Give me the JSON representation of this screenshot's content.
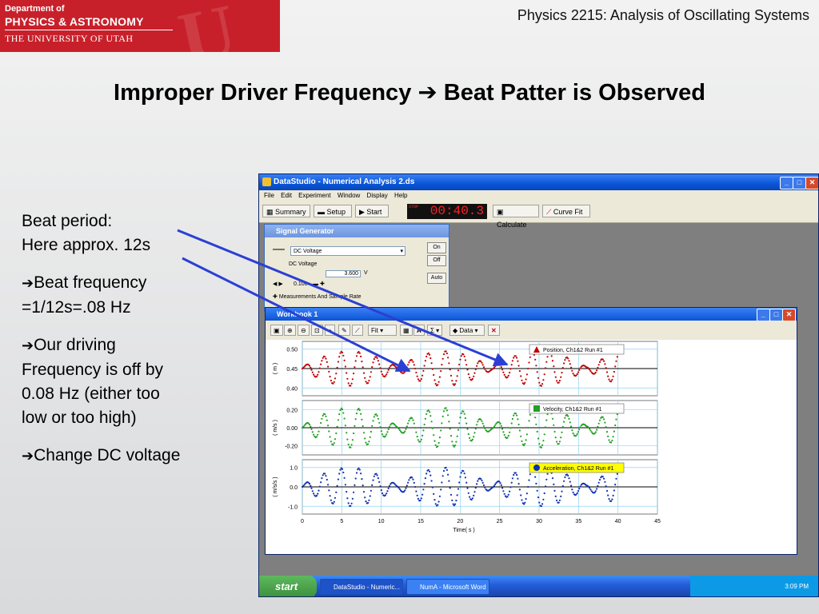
{
  "header": {
    "logo_line1": "Department of",
    "logo_line2": "PHYSICS & ASTRONOMY",
    "logo_line3": "THE UNIVERSITY OF UTAH",
    "course_title": "Physics 2215: Analysis of Oscillating Systems"
  },
  "slide": {
    "title_part1": "Improper Driver Frequency",
    "title_arrow": "➔",
    "title_part2": "Beat Patter is Observed",
    "arrow": "➔",
    "note1_line1": "Beat period:",
    "note1_line2": "Here approx. 12s",
    "note2_line1": "Beat frequency",
    "note2_line2": "=1/12s=.08 Hz",
    "note3": "Our driving Frequency is off by 0.08 Hz (either too low or too high)",
    "note4": "Change DC voltage"
  },
  "app": {
    "window_title": "DataStudio - Numerical Analysis 2.ds",
    "menu": [
      "File",
      "Edit",
      "Experiment",
      "Window",
      "Display",
      "Help"
    ],
    "toolbar": {
      "summary": "Summary",
      "setup": "Setup",
      "start": "Start",
      "stop_label": "STOP",
      "timer": "00:40.3",
      "calculate": "Calculate",
      "curve_fit": "Curve Fit"
    },
    "signal_generator": {
      "title": "Signal Generator",
      "waveform": "DC Voltage",
      "label": "DC Voltage",
      "value": "3.600",
      "unit": "V",
      "step": "0.100",
      "measurements": "Measurements And Sample Rate",
      "on": "On",
      "off": "Off",
      "auto": "Auto"
    },
    "workbook": {
      "title": "Workbook 1",
      "fit": "Fit",
      "data": "Data"
    },
    "taskbar": {
      "start": "start",
      "task1": "DataStudio - Numeric...",
      "task2": "NumA - Microsoft Word",
      "clock": "3:09 PM"
    }
  },
  "chart_data": {
    "type": "line",
    "xlabel": "Time( s )",
    "xlim": [
      0,
      45
    ],
    "x_ticks": [
      "0",
      "5",
      "10",
      "15",
      "20",
      "25",
      "30",
      "35",
      "40",
      "45"
    ],
    "beat_period_s": 12,
    "panels": [
      {
        "name": "Position, Ch1&2 Run #1",
        "ylabel": "( m )",
        "y_ticks": [
          "0.50",
          "0.45",
          "0.40"
        ],
        "ylim": [
          0.38,
          0.52
        ],
        "center": 0.45,
        "amplitude": 0.045,
        "color": "#c00000",
        "marker": "triangle"
      },
      {
        "name": "Velocity, Ch1&2 Run #1",
        "ylabel": "( m/s )",
        "y_ticks": [
          "0.20",
          "0.00",
          "-0.20"
        ],
        "ylim": [
          -0.3,
          0.3
        ],
        "center": 0,
        "amplitude": 0.22,
        "color": "#22a022",
        "marker": "square"
      },
      {
        "name": "Acceleration, Ch1&2 Run #1",
        "ylabel": "( m/s/s )",
        "y_ticks": [
          "1.0",
          "0.0",
          "-1.0"
        ],
        "ylim": [
          -1.4,
          1.4
        ],
        "center": 0,
        "amplitude": 1.0,
        "color": "#1030b0",
        "marker": "circle"
      }
    ]
  }
}
